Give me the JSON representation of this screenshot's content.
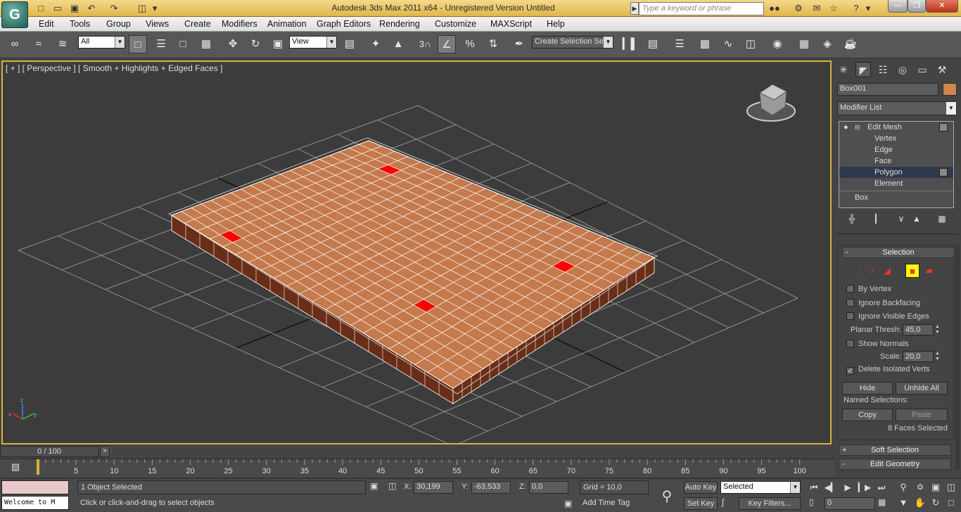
{
  "titlebar": {
    "title": "Autodesk 3ds Max  2011 x64  -  Unregistered Version   Untitled",
    "search_placeholder": "Type a keyword or phrase"
  },
  "menu": [
    "Edit",
    "Tools",
    "Group",
    "Views",
    "Create",
    "Modifiers",
    "Animation",
    "Graph Editors",
    "Rendering",
    "Customize",
    "MAXScript",
    "Help"
  ],
  "toolbar": {
    "selection_filter": "All",
    "reference_coord": "View",
    "named_selection_sets": "Create Selection Se",
    "snap_label": "3"
  },
  "viewport": {
    "label": "[ + ] [ Perspective ] [ Smooth + Highlights + Edged Faces ]",
    "colors": {
      "background": "#3c3c3c",
      "grid": "#8f8f8f",
      "grid_main": "#111111",
      "box_top": "#c47a4c",
      "box_side": "#6a2e18",
      "selected_face": "#ff0000",
      "active_border": "#d9b23a"
    },
    "selected_faces_count": 4
  },
  "command_panel": {
    "object_name": "Box001",
    "object_color": "#d2864f",
    "modifier_list": "Modifier List",
    "stack": [
      {
        "label": "Edit Mesh",
        "level": 0
      },
      {
        "label": "Vertex",
        "level": 1
      },
      {
        "label": "Edge",
        "level": 1
      },
      {
        "label": "Face",
        "level": 1
      },
      {
        "label": "Polygon",
        "level": 1,
        "selected": true
      },
      {
        "label": "Element",
        "level": 1
      },
      {
        "label": "Box",
        "level": 0
      }
    ],
    "selection": {
      "title": "Selection",
      "by_vertex": "By Vertex",
      "ignore_backfacing": "Ignore Backfacing",
      "ignore_visible_edges": "Ignore Visible Edges",
      "planar_thresh_label": "Planar Thresh:",
      "planar_thresh_value": "45,0",
      "show_normals": "Show Normals",
      "scale_label": "Scale:",
      "scale_value": "20,0",
      "delete_isolated_verts": "Delete Isolated Verts",
      "hide": "Hide",
      "unhide_all": "Unhide All",
      "named_selections": "Named Selections:",
      "copy": "Copy",
      "paste": "Paste",
      "faces_selected": "8 Faces Selected"
    },
    "soft_selection": "Soft Selection",
    "edit_geometry": "Edit Geometry"
  },
  "timeline": {
    "slider_label": "0 / 100",
    "ticks": [
      5,
      10,
      15,
      20,
      25,
      30,
      35,
      40,
      45,
      50,
      55,
      60,
      65,
      70,
      75,
      80,
      85,
      90,
      95,
      100
    ]
  },
  "status": {
    "maxscript": "Welcome to M",
    "selection_info": "1 Object Selected",
    "prompt": "Click or click-and-drag to select objects",
    "x_label": "X:",
    "x": "30,199",
    "y_label": "Y:",
    "y": "-63,533",
    "z_label": "Z:",
    "z": "0,0",
    "grid": "Grid = 10,0",
    "add_time_tag": "Add Time Tag",
    "auto_key": "Auto Key",
    "set_key": "Set Key",
    "selected_drop": "Selected",
    "key_filters": "Key Filters...",
    "frame": "0"
  }
}
